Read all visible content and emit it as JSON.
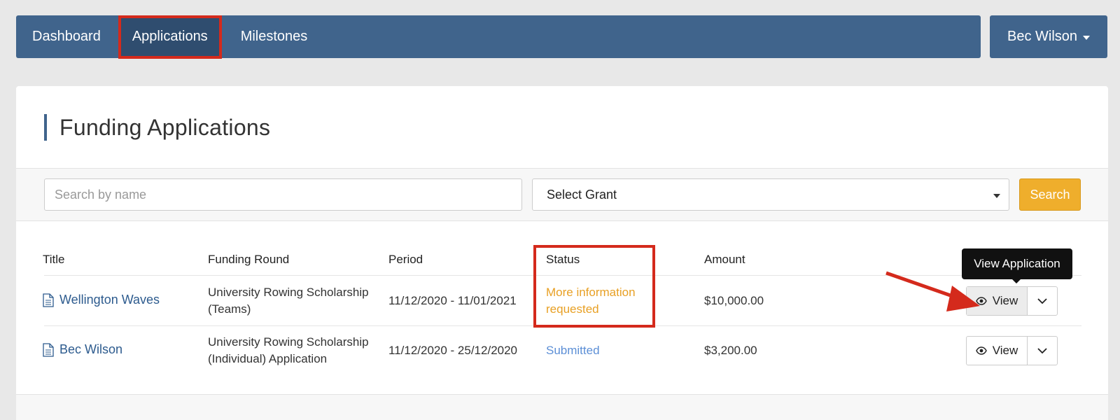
{
  "nav": {
    "items": [
      {
        "label": "Dashboard"
      },
      {
        "label": "Applications"
      },
      {
        "label": "Milestones"
      }
    ],
    "user": "Bec Wilson"
  },
  "page": {
    "title": "Funding Applications"
  },
  "filters": {
    "search_placeholder": "Search by name",
    "grant_select": "Select Grant",
    "search_button": "Search"
  },
  "table": {
    "headers": [
      "Title",
      "Funding Round",
      "Period",
      "Status",
      "Amount"
    ],
    "rows": [
      {
        "title": "Wellington Waves",
        "round_line1": "University Rowing Scholarship",
        "round_line2": "(Teams)",
        "period": "11/12/2020 - 11/01/2021",
        "status_line1": "More information",
        "status_line2": "requested",
        "amount": "$10,000.00",
        "view": "View"
      },
      {
        "title": "Bec Wilson",
        "round_line1": "University Rowing Scholarship",
        "round_line2": "(Individual) Application",
        "period": "11/12/2020 - 25/12/2020",
        "status": "Submitted",
        "amount": "$3,200.00",
        "view": "View"
      }
    ]
  },
  "tooltip": "View Application",
  "colors": {
    "nav": "#40648c",
    "accent_orange": "#efae2c",
    "status_more_info": "#e8a024",
    "status_submitted": "#5c8fd6",
    "annotation_red": "#d42a1c"
  }
}
